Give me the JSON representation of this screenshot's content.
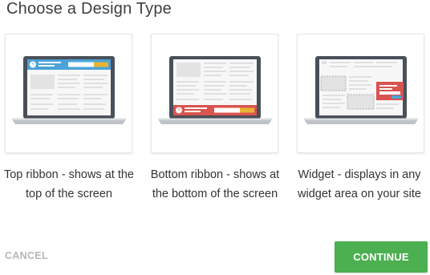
{
  "dialog": {
    "title": "Choose a Design Type"
  },
  "options": [
    {
      "caption": "Top ribbon - shows at the top of the screen",
      "icon": "laptop-top-ribbon-icon"
    },
    {
      "caption": "Bottom ribbon - shows at the bottom of the screen",
      "icon": "laptop-bottom-ribbon-icon"
    },
    {
      "caption": "Widget - displays in any widget area on your site",
      "icon": "laptop-widget-icon"
    }
  ],
  "actions": {
    "cancel_label": "CANCEL",
    "continue_label": "CONTINUE"
  },
  "colors": {
    "accent_green": "#4caf50",
    "ribbon_blue": "#4ba3d9",
    "ribbon_red": "#d9534f",
    "ribbon_yellow": "#e8b431",
    "laptop_frame": "#4a5059"
  }
}
